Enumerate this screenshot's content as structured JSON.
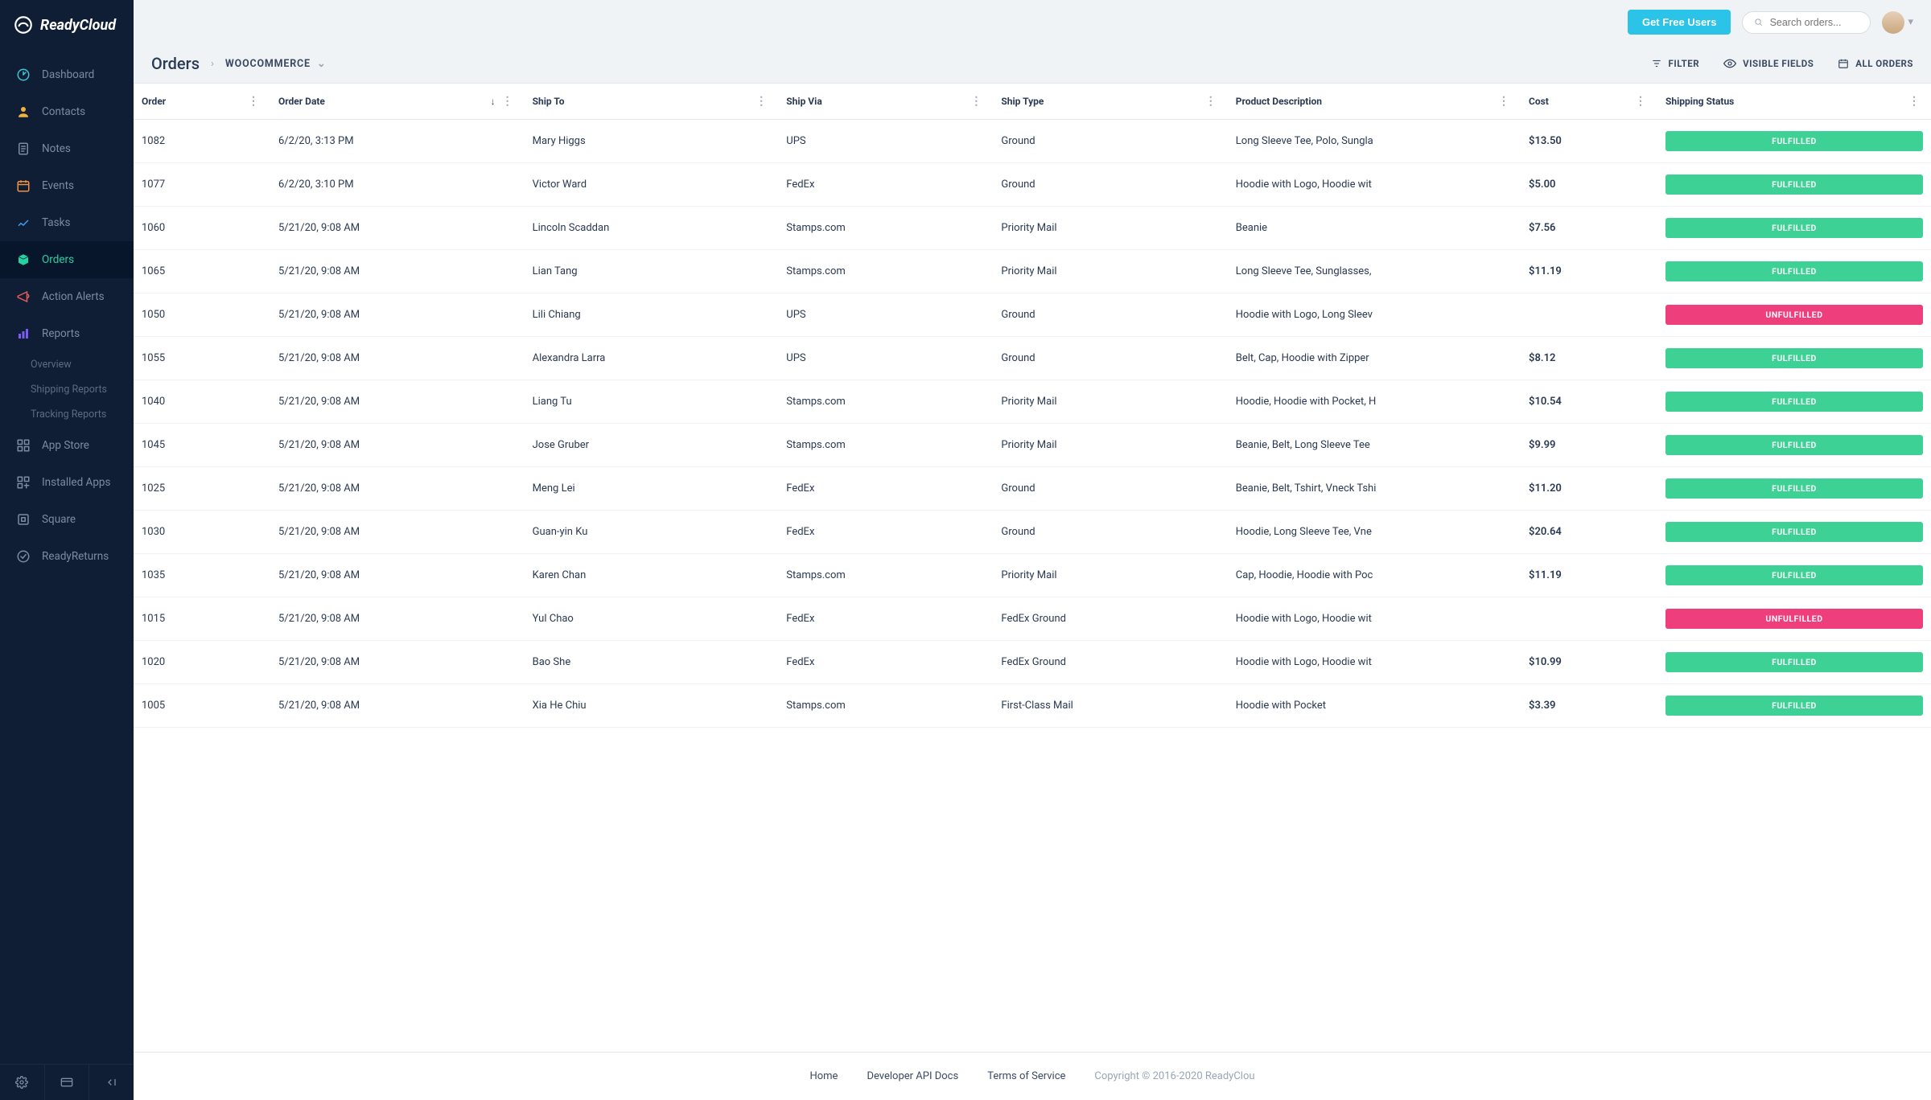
{
  "brand": "ReadyCloud",
  "topbar": {
    "free_users": "Get Free Users",
    "search_placeholder": "Search orders..."
  },
  "sidebar": {
    "items": [
      {
        "label": "Dashboard",
        "icon": "dashboard"
      },
      {
        "label": "Contacts",
        "icon": "contacts"
      },
      {
        "label": "Notes",
        "icon": "notes"
      },
      {
        "label": "Events",
        "icon": "events"
      },
      {
        "label": "Tasks",
        "icon": "tasks"
      },
      {
        "label": "Orders",
        "icon": "orders",
        "active": true
      },
      {
        "label": "Action Alerts",
        "icon": "alerts"
      },
      {
        "label": "Reports",
        "icon": "reports"
      }
    ],
    "report_subs": [
      "Overview",
      "Shipping Reports",
      "Tracking Reports"
    ],
    "extras": [
      {
        "label": "App Store",
        "icon": "appstore"
      },
      {
        "label": "Installed Apps",
        "icon": "installed"
      },
      {
        "label": "Square",
        "icon": "square"
      },
      {
        "label": "ReadyReturns",
        "icon": "returns"
      }
    ]
  },
  "toolbar": {
    "title": "Orders",
    "breadcrumb": "WOOCOMMERCE",
    "filter": "FILTER",
    "visible_fields": "VISIBLE FIELDS",
    "all_orders": "ALL ORDERS"
  },
  "columns": {
    "order": "Order",
    "date": "Order Date",
    "shipto": "Ship To",
    "via": "Ship Via",
    "type": "Ship Type",
    "desc": "Product Description",
    "cost": "Cost",
    "status": "Shipping Status"
  },
  "status_labels": {
    "ok": "FULFILLED",
    "no": "UNFULFILLED"
  },
  "rows": [
    {
      "order": "1082",
      "date": "6/2/20, 3:13 PM",
      "shipto": "Mary Higgs",
      "via": "UPS",
      "type": "Ground",
      "desc": "Long Sleeve Tee, Polo, Sungla",
      "cost": "$13.50",
      "status": "ok"
    },
    {
      "order": "1077",
      "date": "6/2/20, 3:10 PM",
      "shipto": "Victor Ward",
      "via": "FedEx",
      "type": "Ground",
      "desc": "Hoodie with Logo, Hoodie wit",
      "cost": "$5.00",
      "status": "ok"
    },
    {
      "order": "1060",
      "date": "5/21/20, 9:08 AM",
      "shipto": "Lincoln Scaddan",
      "via": "Stamps.com",
      "type": "Priority Mail",
      "desc": "Beanie",
      "cost": "$7.56",
      "status": "ok"
    },
    {
      "order": "1065",
      "date": "5/21/20, 9:08 AM",
      "shipto": "Lian Tang",
      "via": "Stamps.com",
      "type": "Priority Mail",
      "desc": "Long Sleeve Tee, Sunglasses,",
      "cost": "$11.19",
      "status": "ok"
    },
    {
      "order": "1050",
      "date": "5/21/20, 9:08 AM",
      "shipto": "Lili Chiang",
      "via": "UPS",
      "type": "Ground",
      "desc": "Hoodie with Logo, Long Sleev",
      "cost": "",
      "status": "no"
    },
    {
      "order": "1055",
      "date": "5/21/20, 9:08 AM",
      "shipto": "Alexandra Larra",
      "via": "UPS",
      "type": "Ground",
      "desc": "Belt, Cap, Hoodie with Zipper",
      "cost": "$8.12",
      "status": "ok"
    },
    {
      "order": "1040",
      "date": "5/21/20, 9:08 AM",
      "shipto": "Liang Tu",
      "via": "Stamps.com",
      "type": "Priority Mail",
      "desc": "Hoodie, Hoodie with Pocket, H",
      "cost": "$10.54",
      "status": "ok"
    },
    {
      "order": "1045",
      "date": "5/21/20, 9:08 AM",
      "shipto": "Jose Gruber",
      "via": "Stamps.com",
      "type": "Priority Mail",
      "desc": "Beanie, Belt, Long Sleeve Tee",
      "cost": "$9.99",
      "status": "ok"
    },
    {
      "order": "1025",
      "date": "5/21/20, 9:08 AM",
      "shipto": "Meng Lei",
      "via": "FedEx",
      "type": "Ground",
      "desc": "Beanie, Belt, Tshirt, Vneck Tshi",
      "cost": "$11.20",
      "status": "ok"
    },
    {
      "order": "1030",
      "date": "5/21/20, 9:08 AM",
      "shipto": "Guan-yin Ku",
      "via": "FedEx",
      "type": "Ground",
      "desc": "Hoodie, Long Sleeve Tee, Vne",
      "cost": "$20.64",
      "status": "ok"
    },
    {
      "order": "1035",
      "date": "5/21/20, 9:08 AM",
      "shipto": "Karen Chan",
      "via": "Stamps.com",
      "type": "Priority Mail",
      "desc": "Cap, Hoodie, Hoodie with Poc",
      "cost": "$11.19",
      "status": "ok"
    },
    {
      "order": "1015",
      "date": "5/21/20, 9:08 AM",
      "shipto": "Yul Chao",
      "via": "FedEx",
      "type": "FedEx Ground",
      "desc": "Hoodie with Logo, Hoodie wit",
      "cost": "",
      "status": "no"
    },
    {
      "order": "1020",
      "date": "5/21/20, 9:08 AM",
      "shipto": "Bao She",
      "via": "FedEx",
      "type": "FedEx Ground",
      "desc": "Hoodie with Logo, Hoodie wit",
      "cost": "$10.99",
      "status": "ok"
    },
    {
      "order": "1005",
      "date": "5/21/20, 9:08 AM",
      "shipto": "Xia He Chiu",
      "via": "Stamps.com",
      "type": "First-Class Mail",
      "desc": "Hoodie with Pocket",
      "cost": "$3.39",
      "status": "ok"
    }
  ],
  "footer": {
    "home": "Home",
    "api": "Developer API Docs",
    "tos": "Terms of Service",
    "copy": "Copyright © 2016-2020 ReadyClou"
  }
}
